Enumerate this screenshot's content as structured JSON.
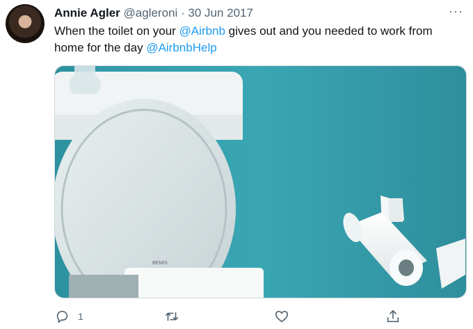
{
  "tweet": {
    "author_name": "Annie Agler",
    "handle": "@agleroni",
    "separator": " · ",
    "date": "30 Jun 2017",
    "more_label": "···",
    "text_parts": [
      "When the toilet on your ",
      "@Airbnb",
      " gives out and you needed to work from home for the day ",
      "@AirbnbHelp"
    ],
    "media": {
      "lid_brand": "BEMIS"
    },
    "actions": {
      "reply_count": "1"
    }
  },
  "colors": {
    "link": "#1d9bf0",
    "muted": "#536471",
    "wall_teal": "#3aa6b3",
    "porcelain": "#f1f4f4"
  },
  "icons": [
    "reply-icon",
    "retweet-icon",
    "like-icon",
    "share-icon",
    "more-icon"
  ]
}
